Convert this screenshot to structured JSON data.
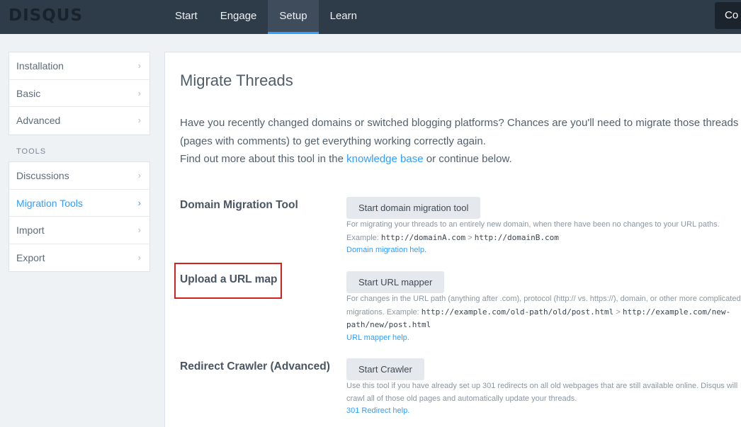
{
  "header": {
    "logo": "DISQUS",
    "nav": [
      "Start",
      "Engage",
      "Setup",
      "Learn"
    ],
    "active_nav": "Setup",
    "code_button": "Co"
  },
  "sidebar": {
    "group1": [
      "Installation",
      "Basic",
      "Advanced"
    ],
    "tools_label": "TOOLS",
    "group2": [
      "Discussions",
      "Migration Tools",
      "Import",
      "Export"
    ],
    "active": "Migration Tools",
    "chevron": "›"
  },
  "main": {
    "title": "Migrate Threads",
    "intro_line1": "Have you recently changed domains or switched blogging platforms? Chances are you'll need to migrate those threads (pages with comments) to get everything working correctly again.",
    "intro_line2_pre": "Find out more about this tool in the ",
    "intro_link": "knowledge base",
    "intro_line2_post": " or continue below.",
    "tools": [
      {
        "title": "Domain Migration Tool",
        "button": "Start domain migration tool",
        "desc": "For migrating your threads to an entirely new domain, when there have been no changes to your URL paths.",
        "example_label": "Example: ",
        "example_from": "http://domainA.com",
        "example_sep": " > ",
        "example_to": "http://domainB.com",
        "help": "Domain migration help."
      },
      {
        "title": "Upload a URL map",
        "button": "Start URL mapper",
        "desc": "For changes in the URL path (anything after .com), protocol (http:// vs. https://), domain, or other more complicated migrations.",
        "example_label": " Example: ",
        "example_from": "http://example.com/old-path/old/post.html",
        "example_sep": " > ",
        "example_to": "http://example.com/new-path/new/post.html",
        "help": "URL mapper help."
      },
      {
        "title": "Redirect Crawler (Advanced)",
        "button": "Start Crawler",
        "desc": "Use this tool if you have already set up 301 redirects on all old webpages that are still available online. Disqus will crawl all of those old pages and automatically update your threads.",
        "help": "301 Redirect help."
      }
    ]
  },
  "colors": {
    "accent": "#2e9fff",
    "topbar": "#2e3b48",
    "highlight_box": "#d62020"
  }
}
